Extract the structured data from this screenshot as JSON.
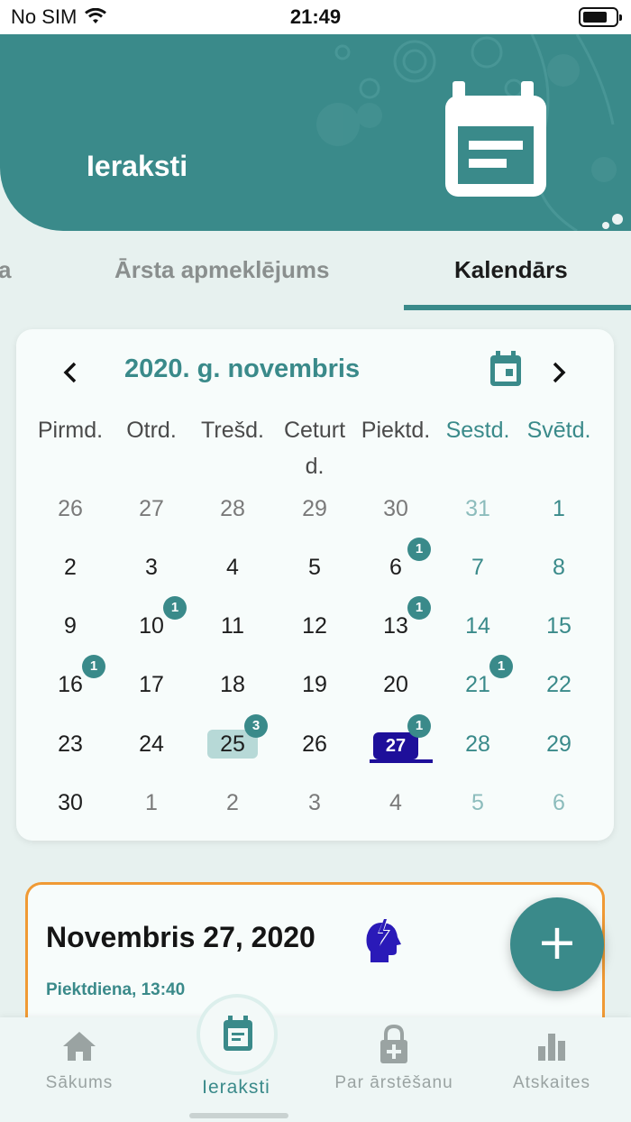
{
  "status_bar": {
    "carrier": "No SIM",
    "time": "21:49"
  },
  "header": {
    "title": "Ieraksti",
    "icon": "calendar-note-icon"
  },
  "tabs": [
    {
      "label": "a",
      "active": false
    },
    {
      "label": "Ārsta apmeklējums",
      "active": false
    },
    {
      "label": "Kalendārs",
      "active": true
    }
  ],
  "calendar": {
    "month_label": "2020. g. novembris",
    "prev_icon": "chevron-left-icon",
    "next_icon": "chevron-right-icon",
    "picker_icon": "calendar-icon",
    "weekdays": [
      "Pirmd.",
      "Otrd.",
      "Trešd.",
      "Ceturt\nd.",
      "Piektd.",
      "Sestd.",
      "Svētd."
    ],
    "weeks": [
      [
        {
          "d": "26",
          "other": true
        },
        {
          "d": "27",
          "other": true
        },
        {
          "d": "28",
          "other": true
        },
        {
          "d": "29",
          "other": true
        },
        {
          "d": "30",
          "other": true
        },
        {
          "d": "31",
          "other": true
        },
        {
          "d": "1"
        }
      ],
      [
        {
          "d": "2"
        },
        {
          "d": "3"
        },
        {
          "d": "4"
        },
        {
          "d": "5"
        },
        {
          "d": "6",
          "badge": "1"
        },
        {
          "d": "7"
        },
        {
          "d": "8"
        }
      ],
      [
        {
          "d": "9"
        },
        {
          "d": "10",
          "badge": "1"
        },
        {
          "d": "11"
        },
        {
          "d": "12"
        },
        {
          "d": "13",
          "badge": "1"
        },
        {
          "d": "14"
        },
        {
          "d": "15"
        }
      ],
      [
        {
          "d": "16",
          "badge": "1"
        },
        {
          "d": "17"
        },
        {
          "d": "18"
        },
        {
          "d": "19"
        },
        {
          "d": "20"
        },
        {
          "d": "21",
          "badge": "1"
        },
        {
          "d": "22"
        }
      ],
      [
        {
          "d": "23"
        },
        {
          "d": "24"
        },
        {
          "d": "25",
          "badge": "3",
          "selected": true
        },
        {
          "d": "26"
        },
        {
          "d": "27",
          "badge": "1",
          "today": true
        },
        {
          "d": "28"
        },
        {
          "d": "29"
        }
      ],
      [
        {
          "d": "30"
        },
        {
          "d": "1",
          "other": true
        },
        {
          "d": "2",
          "other": true
        },
        {
          "d": "3",
          "other": true
        },
        {
          "d": "4",
          "other": true
        },
        {
          "d": "5",
          "other": true
        },
        {
          "d": "6",
          "other": true
        }
      ]
    ]
  },
  "event": {
    "date": "Novembris 27, 2020",
    "icon": "head-lightning-icon",
    "subtitle": "Piektdiena, 13:40"
  },
  "fab": {
    "label": "+"
  },
  "bottom_nav": [
    {
      "label": "Sākums",
      "icon": "home-icon",
      "active": false
    },
    {
      "label": "Ieraksti",
      "icon": "calendar-note-icon",
      "active": true
    },
    {
      "label": "Par ārstēšanu",
      "icon": "lock-plus-icon",
      "active": false
    },
    {
      "label": "Atskaites",
      "icon": "bar-chart-icon",
      "active": false
    }
  ],
  "colors": {
    "primary": "#3a8a8a",
    "today": "#1e0f9a",
    "event_border": "#f09a34",
    "background": "#e7f1ef"
  }
}
